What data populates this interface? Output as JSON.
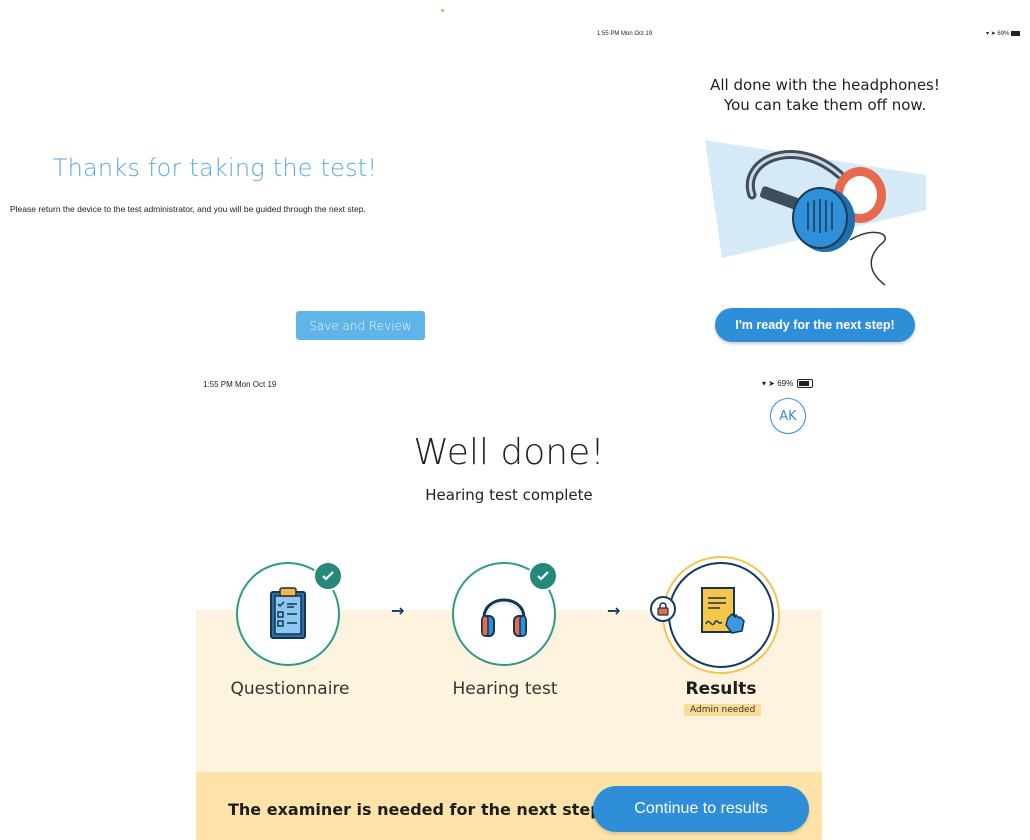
{
  "top_left": {
    "title": "Thanks for taking the test!",
    "body": "Please return the device to the test administrator, and you will be guided through the next step.",
    "save_button": "Save and Review"
  },
  "top_right": {
    "status_time": "1:55 PM  Mon Oct 19",
    "status_battery": "69%",
    "message_line1": "All done with the headphones!",
    "message_line2": "You can take them off now.",
    "ready_button": "I'm ready for the next step!"
  },
  "bottom": {
    "status_time": "1:55 PM  Mon Oct 19",
    "status_battery": "69%",
    "user_initials": "AK",
    "heading": "Well done!",
    "subtitle": "Hearing test complete",
    "steps": [
      {
        "label": "Questionnaire",
        "icon": "clipboard-icon",
        "complete": true
      },
      {
        "label": "Hearing test",
        "icon": "headphones-icon",
        "complete": true
      },
      {
        "label": "Results",
        "icon": "document-signature-icon",
        "complete": false,
        "locked": true,
        "badge": "Admin needed"
      }
    ],
    "cta_text": "The examiner is needed for the next step",
    "continue_button": "Continue to results"
  },
  "colors": {
    "accent_blue": "#2e8fd8",
    "teal_check": "#23897a",
    "panel_cream": "#fdf3df",
    "cta_yellow": "#fde3a7"
  }
}
